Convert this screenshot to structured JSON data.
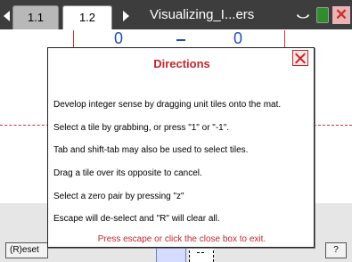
{
  "tabbar": {
    "tabs": [
      {
        "label": "1.1"
      },
      {
        "label": "1.2"
      }
    ],
    "doc_title": "Visualizing_I...ers",
    "close_label": "✕"
  },
  "workspace": {
    "left_value": "0",
    "right_value": "0",
    "reset_label": "(R)eset",
    "help_label": "?"
  },
  "dialog": {
    "title": "Directions",
    "lines": [
      "Develop integer sense by dragging unit tiles onto the mat.",
      "Select a tile by grabbing, or press \"1\" or \"-1\".",
      "Tab and shift-tab may also be used to select tiles.",
      "Drag a tile over its opposite to cancel.",
      "Select a zero pair by pressing \"z\"",
      "Escape will de-select and \"R\" will clear all."
    ],
    "footer": "Press escape or click the close box to exit."
  },
  "colors": {
    "accent_red": "#c2262b",
    "blue": "#1e4db8",
    "tabbar": "#3d3d3d"
  }
}
